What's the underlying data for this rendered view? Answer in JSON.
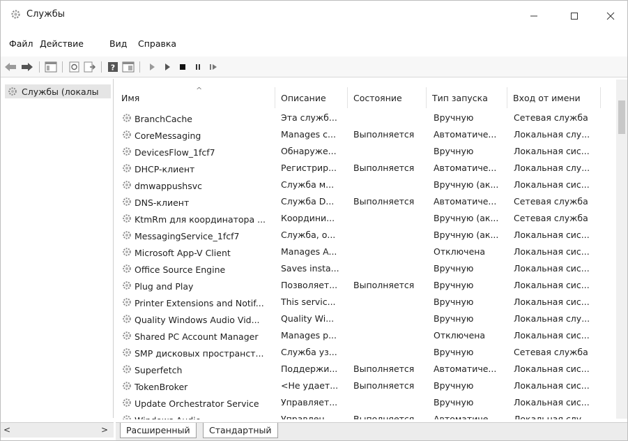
{
  "window": {
    "title": "Службы",
    "icon": "gear-icon"
  },
  "menu": [
    "Файл",
    "Действие",
    "Вид",
    "Справка"
  ],
  "toolbar": {
    "icons": [
      "back-icon",
      "forward-icon",
      "console-tree-icon",
      "refresh-icon",
      "export-icon",
      "help-icon",
      "properties-icon",
      "start-icon",
      "start-alt-icon",
      "stop-icon",
      "pause-icon",
      "restart-icon"
    ]
  },
  "tree": {
    "item": "Службы (локалы"
  },
  "table": {
    "columns": [
      "Имя",
      "Описание",
      "Состояние",
      "Тип запуска",
      "Вход от имени"
    ],
    "rows": [
      [
        "BranchCache",
        "Эта служб...",
        "",
        "Вручную",
        "Сетевая служба"
      ],
      [
        "CoreMessaging",
        "Manages c...",
        "Выполняется",
        "Автоматиче...",
        "Локальная слу..."
      ],
      [
        "DevicesFlow_1fcf7",
        "Обнаруже...",
        "",
        "Вручную",
        "Локальная сис..."
      ],
      [
        "DHCP-клиент",
        "Регистрир...",
        "Выполняется",
        "Автоматиче...",
        "Локальная слу..."
      ],
      [
        "dmwappushsvc",
        "Служба м...",
        "",
        "Вручную (ак...",
        "Локальная сис..."
      ],
      [
        "DNS-клиент",
        "Служба D...",
        "Выполняется",
        "Автоматиче...",
        "Сетевая служба"
      ],
      [
        "KtmRm для координатора ...",
        "Координи...",
        "",
        "Вручную (ак...",
        "Сетевая служба"
      ],
      [
        "MessagingService_1fcf7",
        "Служба, о...",
        "",
        "Вручную (ак...",
        "Локальная сис..."
      ],
      [
        "Microsoft App-V Client",
        "Manages A...",
        "",
        "Отключена",
        "Локальная сис..."
      ],
      [
        "Office Source Engine",
        "Saves insta...",
        "",
        "Вручную",
        "Локальная сис..."
      ],
      [
        "Plug and Play",
        "Позволяет...",
        "Выполняется",
        "Вручную",
        "Локальная сис..."
      ],
      [
        "Printer Extensions and Notif...",
        "This servic...",
        "",
        "Вручную",
        "Локальная сис..."
      ],
      [
        "Quality Windows Audio Vid...",
        "Quality Wi...",
        "",
        "Вручную",
        "Локальная слу..."
      ],
      [
        "Shared PC Account Manager",
        "Manages p...",
        "",
        "Отключена",
        "Локальная сис..."
      ],
      [
        "SMP дисковых пространст...",
        "Служба уз...",
        "",
        "Вручную",
        "Сетевая служба"
      ],
      [
        "Superfetch",
        "Поддержи...",
        "Выполняется",
        "Автоматиче...",
        "Локальная сис..."
      ],
      [
        "TokenBroker",
        "<Не удает...",
        "Выполняется",
        "Вручную",
        "Локальная сис..."
      ],
      [
        "Update Orchestrator Service",
        "Управляет...",
        "",
        "Вручную",
        "Локальная сис..."
      ],
      [
        "Windows Audio",
        "Управлен...",
        "Выполняется",
        "Автоматиче...",
        "Локальная слу..."
      ]
    ]
  },
  "scrollbar": {
    "left": "<",
    "right": ">"
  },
  "tabs": [
    "Расширенный",
    "Стандартный"
  ]
}
